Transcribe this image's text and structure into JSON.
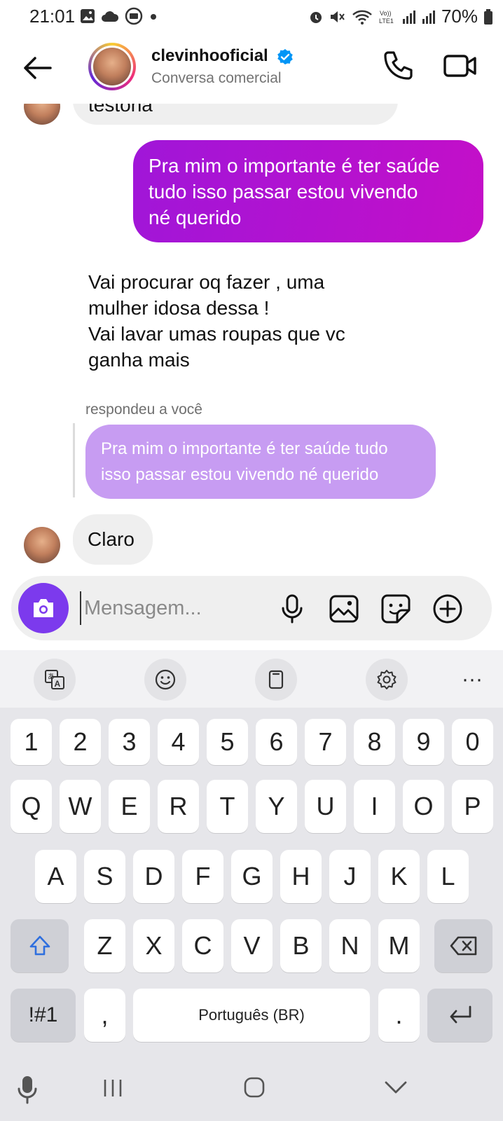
{
  "status_bar": {
    "time": "21:01",
    "battery": "70%",
    "icons": [
      "image-icon",
      "cloud-icon",
      "money-icon",
      "dot-icon",
      "alarm-icon",
      "mute-icon",
      "wifi-icon",
      "volte-icon",
      "signal-icon",
      "signal-icon",
      "battery-icon"
    ]
  },
  "header": {
    "name": "clevinhooficial",
    "subtitle": "Conversa comercial",
    "verified_color": "#0095f6"
  },
  "messages": {
    "m0_text": "testona",
    "m1_lines": [
      "Pra mim o importante é ter saúde",
      "tudo isso passar estou vivendo",
      "né querido"
    ],
    "m2_lines": [
      "Vai procurar oq fazer , uma",
      "mulher idosa dessa !",
      "Vai lavar umas roupas que vc",
      "ganha mais"
    ],
    "reply_label": "respondeu a você",
    "reply_lines": [
      "Pra mim o importante é ter saúde tudo",
      "isso passar estou vivendo né querido"
    ],
    "m3_text": "Claro"
  },
  "composer": {
    "placeholder": "Mensagem..."
  },
  "keyboard": {
    "row_numbers": [
      "1",
      "2",
      "3",
      "4",
      "5",
      "6",
      "7",
      "8",
      "9",
      "0"
    ],
    "row1": [
      "Q",
      "W",
      "E",
      "R",
      "T",
      "Y",
      "U",
      "I",
      "O",
      "P"
    ],
    "row2": [
      "A",
      "S",
      "D",
      "F",
      "G",
      "H",
      "J",
      "K",
      "L"
    ],
    "row3": [
      "Z",
      "X",
      "C",
      "V",
      "B",
      "N",
      "M"
    ],
    "symbols_key": "!#1",
    "comma_key": ",",
    "space_label": "Português (BR)",
    "period_key": ".",
    "more_glyph": "···"
  },
  "colors": {
    "outgoing_gradient_start": "#a016d8",
    "outgoing_gradient_end": "#c40fc8",
    "reply_bubble": "#c79cf2",
    "camera_button": "#7c3aed",
    "shift_icon": "#2f6fde"
  }
}
